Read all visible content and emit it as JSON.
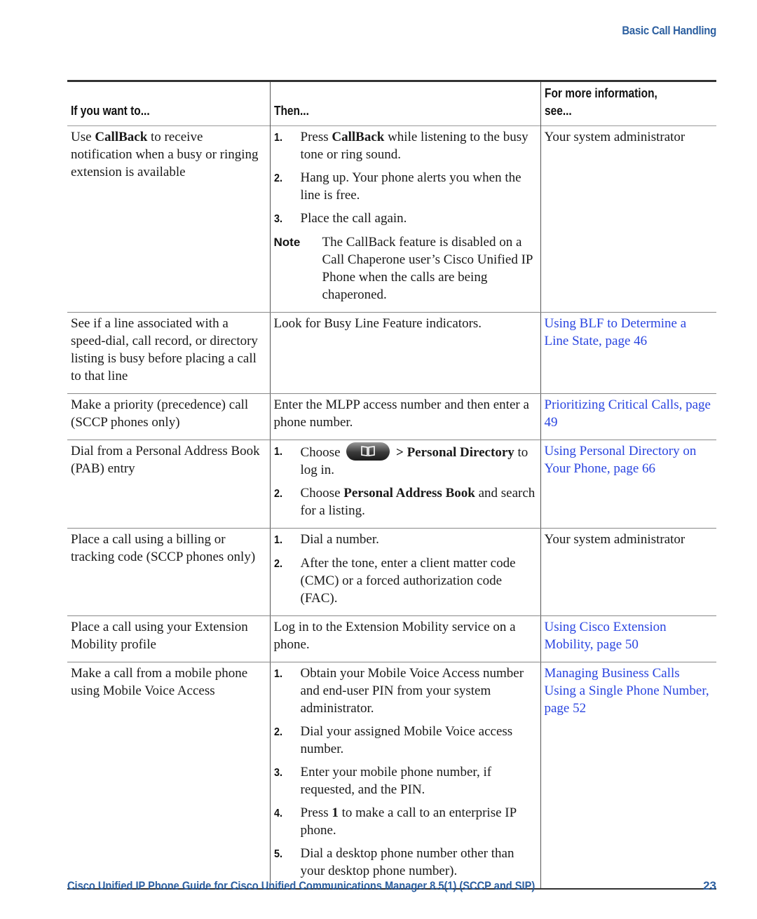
{
  "running_head": "Basic Call Handling",
  "table": {
    "headers": [
      "If you want to...",
      "Then...",
      "For more information, see..."
    ],
    "rows": [
      {
        "want_parts": [
          {
            "t": "Use "
          },
          {
            "t": "CallBack",
            "b": true
          },
          {
            "t": " to receive notification when a busy or ringing extension is available"
          }
        ],
        "steps": [
          {
            "n": "1.",
            "parts": [
              {
                "t": "Press "
              },
              {
                "t": "CallBack",
                "b": true
              },
              {
                "t": " while listening to the busy tone or ring sound."
              }
            ]
          },
          {
            "n": "2.",
            "parts": [
              {
                "t": "Hang up. Your phone alerts you when the line is free."
              }
            ]
          },
          {
            "n": "3.",
            "parts": [
              {
                "t": "Place the call again."
              }
            ]
          }
        ],
        "note": {
          "label": "Note",
          "text": "The CallBack feature is disabled on a Call Chaperone user’s Cisco Unified IP Phone when the calls are being chaperoned."
        },
        "info": {
          "text": "Your system administrator",
          "link": false
        }
      },
      {
        "want_parts": [
          {
            "t": "See if a line associated with a speed-dial, call record, or directory listing is busy before placing a call to that line"
          }
        ],
        "then_text": "Look for Busy Line Feature indicators.",
        "info": {
          "text": "Using BLF to Determine a Line State, page 46",
          "link": true
        }
      },
      {
        "want_parts": [
          {
            "t": "Make a priority (precedence) call (SCCP phones only)"
          }
        ],
        "then_text": "Enter the MLPP access number and then enter a phone number.",
        "info": {
          "text": "Prioritizing Critical Calls, page 49",
          "link": true
        }
      },
      {
        "want_parts": [
          {
            "t": "Dial from a Personal Address Book (PAB) entry"
          }
        ],
        "steps": [
          {
            "n": "1.",
            "parts": [
              {
                "t": "Choose "
              },
              {
                "icon": "directories-button-icon"
              },
              {
                "t": " > Personal Directory",
                "b": true
              },
              {
                "t": " to log in."
              }
            ]
          },
          {
            "n": "2.",
            "parts": [
              {
                "t": "Choose "
              },
              {
                "t": "Personal Address Book",
                "b": true
              },
              {
                "t": " and search for a listing."
              }
            ]
          }
        ],
        "info": {
          "text": "Using Personal Directory on Your Phone, page 66",
          "link": true
        }
      },
      {
        "want_parts": [
          {
            "t": "Place a call using a billing or tracking code (SCCP phones only)"
          }
        ],
        "steps": [
          {
            "n": "1.",
            "parts": [
              {
                "t": "Dial a number."
              }
            ]
          },
          {
            "n": "2.",
            "parts": [
              {
                "t": "After the tone, enter a client matter code (CMC) or a forced authorization code (FAC)."
              }
            ]
          }
        ],
        "info": {
          "text": "Your system administrator",
          "link": false
        }
      },
      {
        "want_parts": [
          {
            "t": "Place a call using your Extension Mobility profile"
          }
        ],
        "then_text": "Log in to the Extension Mobility service on a phone.",
        "info": {
          "text": "Using Cisco Extension Mobility, page 50",
          "link": true
        }
      },
      {
        "want_parts": [
          {
            "t": "Make a call from a mobile phone using Mobile Voice Access"
          }
        ],
        "steps": [
          {
            "n": "1.",
            "parts": [
              {
                "t": "Obtain your Mobile Voice Access number and end-user PIN from your system administrator."
              }
            ]
          },
          {
            "n": "2.",
            "parts": [
              {
                "t": "Dial your assigned Mobile Voice access number."
              }
            ]
          },
          {
            "n": "3.",
            "parts": [
              {
                "t": "Enter your mobile phone number, if requested, and the PIN."
              }
            ]
          },
          {
            "n": "4.",
            "parts": [
              {
                "t": "Press "
              },
              {
                "t": "1",
                "b": true
              },
              {
                "t": " to make a call to an enterprise IP phone."
              }
            ]
          },
          {
            "n": "5.",
            "parts": [
              {
                "t": "Dial a desktop phone number other than your desktop phone number)."
              }
            ]
          }
        ],
        "info": {
          "text": "Managing Business Calls Using a Single Phone Number, page 52",
          "link": true
        }
      }
    ]
  },
  "footer": {
    "title": "Cisco Unified IP Phone Guide for Cisco Unified Communications Manager 8.5(1) (SCCP and SIP)",
    "page_number": "23"
  },
  "colors": {
    "heading_blue": "#2c5fa0",
    "link_blue": "#2a45e0"
  }
}
